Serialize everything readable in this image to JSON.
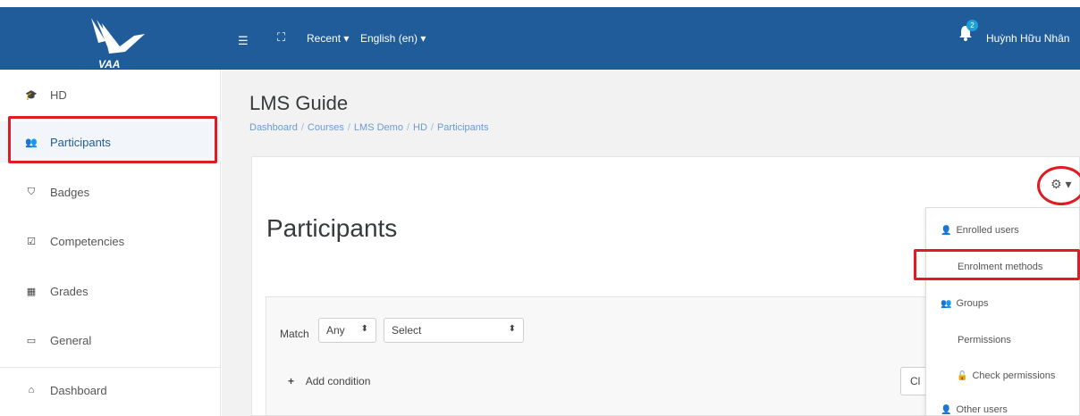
{
  "colors": {
    "header": "#1f5c99",
    "highlight": "#e01b22",
    "link": "#6a9bd1"
  },
  "header": {
    "logo_text": "VAA",
    "menu_icon": "hamburger-icon",
    "fullscreen_icon": "fullscreen-icon",
    "recent_label": "Recent ▾",
    "language_label": "English (en) ▾",
    "notification_count": "2",
    "user_name": "Huỳnh Hữu Nhân"
  },
  "sidebar": {
    "items": [
      {
        "label": "HD",
        "icon": "graduation-cap-icon",
        "glyph": "🎓"
      },
      {
        "label": "Participants",
        "icon": "users-icon",
        "glyph": "👥"
      },
      {
        "label": "Badges",
        "icon": "shield-icon",
        "glyph": "⛉"
      },
      {
        "label": "Competencies",
        "icon": "check-square-icon",
        "glyph": "☑"
      },
      {
        "label": "Grades",
        "icon": "table-icon",
        "glyph": "▦"
      },
      {
        "label": "General",
        "icon": "folder-icon",
        "glyph": "▭"
      },
      {
        "label": "Dashboard",
        "icon": "home-icon",
        "glyph": "⌂"
      }
    ]
  },
  "main": {
    "course_title": "LMS Guide",
    "breadcrumb": [
      "Dashboard",
      "Courses",
      "LMS Demo",
      "HD",
      "Participants"
    ],
    "page_heading": "Participants",
    "gear_glyph": "⚙ ▾",
    "filter": {
      "match_label": "Match",
      "match_value": "Any",
      "select_value": "Select",
      "add_condition": "Add condition",
      "clear_label": "Cl"
    }
  },
  "dropdown": {
    "items": [
      {
        "label": "Enrolled users",
        "icon": "user-plus-icon",
        "glyph": "👤"
      },
      {
        "label": "Enrolment methods"
      },
      {
        "label": "Groups",
        "icon": "users-icon",
        "glyph": "👥"
      },
      {
        "label": "Permissions"
      },
      {
        "label": "Check permissions",
        "icon": "unlock-icon",
        "glyph": "🔓"
      },
      {
        "label": "Other users",
        "icon": "user-plus-icon",
        "glyph": "👤"
      }
    ]
  }
}
